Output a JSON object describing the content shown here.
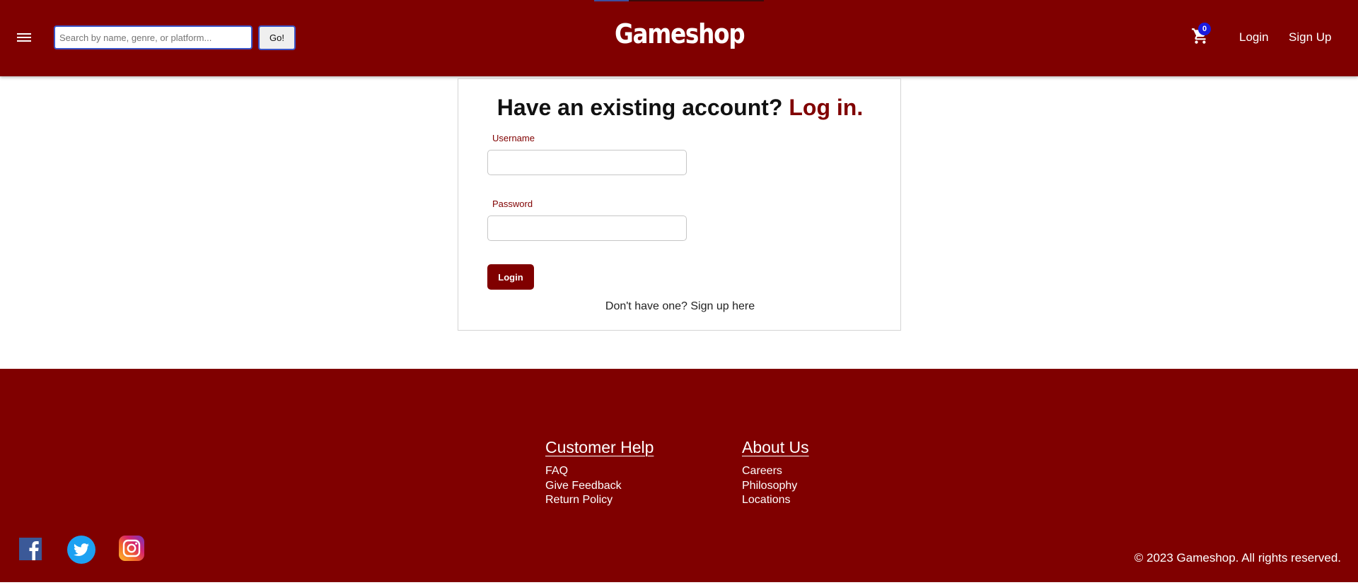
{
  "header": {
    "brand": "Gameshop",
    "search_placeholder": "Search by name, genre, or platform...",
    "search_value": "",
    "go_label": "Go!",
    "cart_count": "0",
    "nav_login": "Login",
    "nav_signup": "Sign Up",
    "colors": {
      "primary": "#800000",
      "badge": "#1a1adf",
      "search_border": "#3a55c8"
    }
  },
  "login_form": {
    "title_prefix": "Have an existing account?",
    "title_accent": "Log in.",
    "username_label": "Username",
    "username_value": "",
    "password_label": "Password",
    "password_value": "",
    "submit_label": "Login",
    "signup_prompt": "Don't have one?",
    "signup_link": "Sign up here"
  },
  "footer": {
    "columns": [
      {
        "heading": "Customer Help",
        "links": [
          "FAQ",
          "Give Feedback",
          "Return Policy"
        ]
      },
      {
        "heading": "About Us",
        "links": [
          "Careers",
          "Philosophy",
          "Locations"
        ]
      }
    ],
    "social": [
      "facebook-icon",
      "twitter-icon",
      "instagram-icon"
    ],
    "copyright": "© 2023 Gameshop. All rights reserved."
  },
  "icons": {
    "menu": "menu-icon",
    "cart": "cart-icon"
  }
}
